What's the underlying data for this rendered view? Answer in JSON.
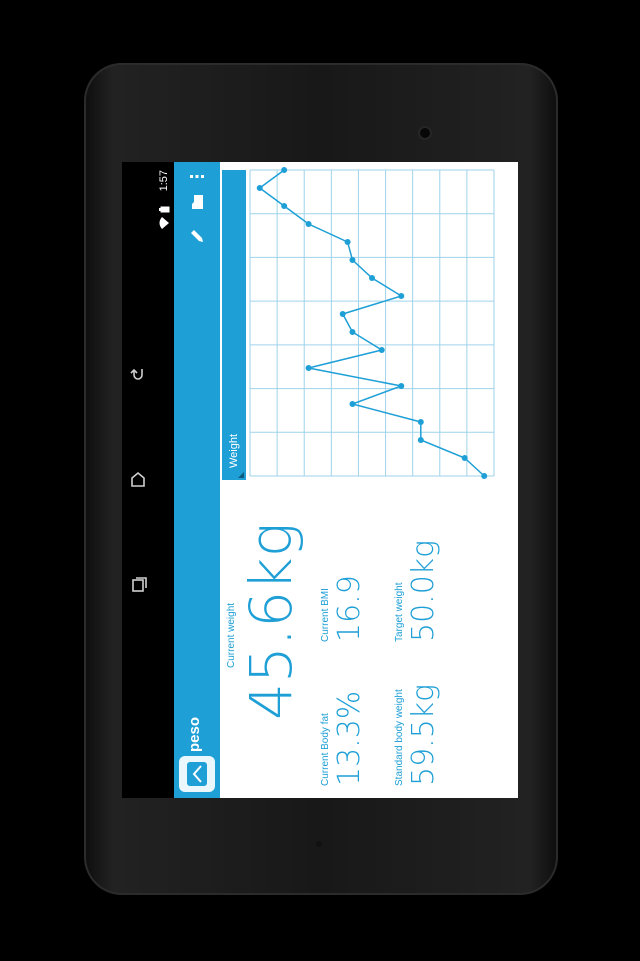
{
  "status_bar": {
    "time": "1:57"
  },
  "app": {
    "title": "peso"
  },
  "actions": {
    "weight_dropdown_label": "Weight"
  },
  "metrics": {
    "current_weight_label": "Current weight",
    "current_weight_value": "45.6kg",
    "current_bmi_label": "Current BMI",
    "current_bmi_value": "16.9",
    "current_body_fat_label": "Current Body fat",
    "current_body_fat_value": "13.3%",
    "target_weight_label": "Target weight",
    "target_weight_value": "50.0kg",
    "standard_body_weight_label": "Standard body weight",
    "standard_body_weight_value": "59.5kg"
  },
  "colors": {
    "accent": "#1e9fd6",
    "background": "#ffffff",
    "grid": "#9fd3ea"
  },
  "chart_data": {
    "type": "line",
    "series": [
      {
        "values": [
          43.2,
          43.6,
          44.5,
          44.5,
          45.9,
          44.9,
          46.8,
          45.3,
          45.9,
          46.1,
          44.9,
          45.5,
          45.9,
          46.0,
          46.8,
          47.3,
          47.8,
          47.3
        ]
      }
    ],
    "grid": true
  }
}
